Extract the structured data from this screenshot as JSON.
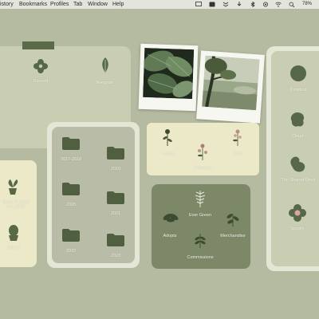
{
  "menubar": {
    "items": [
      "istory",
      "Bookmarks",
      "Profiles",
      "Tab",
      "Window",
      "Help"
    ],
    "battery": "78%"
  },
  "apps_panel": {
    "discord": "Discord",
    "telegram": "Telegram"
  },
  "folders": [
    {
      "label": "2017-2018"
    },
    {
      "label": "2019"
    },
    {
      "label": "2020"
    },
    {
      "label": "2021"
    },
    {
      "label": "2022"
    },
    {
      "label": "2023"
    }
  ],
  "left_panel": {
    "item1": "Book Projects\nPre 2023",
    "item2": "Dinner"
  },
  "flowers_panel": {
    "things": "Things",
    "calendar": "Calendar",
    "todo": "Todo"
  },
  "leaves_panel": {
    "evergreen": "Ever Green",
    "adopts": "Adopts",
    "merchandise": "Merchandise",
    "commissions": "Commissions"
  },
  "right_panel": {
    "dropbox": "Dropbox",
    "cloud": "Cloud",
    "shared": "The Shared Drive",
    "spotify": "Spotify"
  },
  "colors": {
    "background": "#b4bba0",
    "dark_green": "#566847",
    "panel_light": "#c9cdb2",
    "panel_cream": "#ece9c9"
  }
}
